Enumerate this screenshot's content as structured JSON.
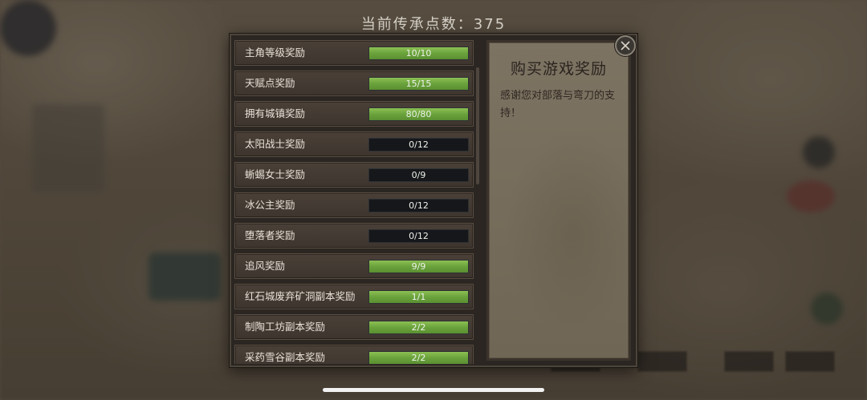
{
  "header": {
    "legacy_points_label": "当前传承点数：375"
  },
  "rewards": [
    {
      "label": "主角等级奖励",
      "progress_text": "10/10",
      "fill": 1.0
    },
    {
      "label": "天赋点奖励",
      "progress_text": "15/15",
      "fill": 1.0
    },
    {
      "label": "拥有城镇奖励",
      "progress_text": "80/80",
      "fill": 1.0
    },
    {
      "label": "太阳战士奖励",
      "progress_text": "0/12",
      "fill": 0.0
    },
    {
      "label": "蜥蜴女士奖励",
      "progress_text": "0/9",
      "fill": 0.0
    },
    {
      "label": "冰公主奖励",
      "progress_text": "0/12",
      "fill": 0.0
    },
    {
      "label": "堕落者奖励",
      "progress_text": "0/12",
      "fill": 0.0
    },
    {
      "label": "追风奖励",
      "progress_text": "9/9",
      "fill": 1.0
    },
    {
      "label": "红石城废弃矿洞副本奖励",
      "progress_text": "1/1",
      "fill": 1.0
    },
    {
      "label": "制陶工坊副本奖励",
      "progress_text": "2/2",
      "fill": 1.0
    },
    {
      "label": "采药雪谷副本奖励",
      "progress_text": "2/2",
      "fill": 1.0
    }
  ],
  "info_card": {
    "title": "购买游戏奖励",
    "body": "感谢您对部落与弯刀的支持！"
  },
  "colors": {
    "bar_fill": "#6aa23c",
    "bar_empty": "#15171a",
    "panel_bg": "#2b2622"
  },
  "icons": {
    "close": "close-icon"
  }
}
